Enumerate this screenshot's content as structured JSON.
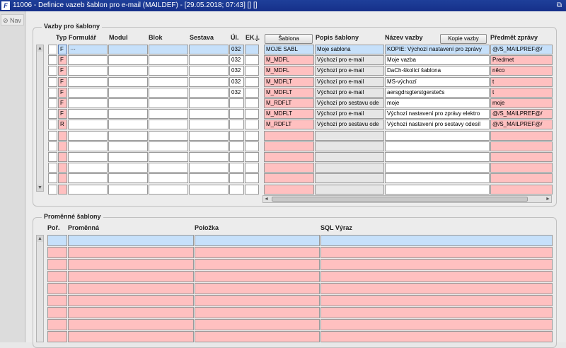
{
  "window": {
    "title": "11006 - Definice vazeb šablon pro e-mail (MAILDEF) - [29.05.2018; 07:43] [] []",
    "icon_text": "F",
    "controls": [
      "⧉",
      "✕"
    ]
  },
  "nav": {
    "label": "Nav"
  },
  "vazby": {
    "group_title": "Vazby pro šablony",
    "headers": {
      "typ": "Typ",
      "formular": "Formulář",
      "modul": "Modul",
      "blok": "Blok",
      "sestava": "Sestava",
      "ul": "Úl.",
      "ekj": "EK.j.",
      "popis": "Popis šablony",
      "nazev": "Název vazby",
      "predmet": "Předmět zprávy"
    },
    "sablona_button": "Šablona",
    "kopie_button": "Kopie vazby",
    "left_rows": [
      {
        "typ": "F",
        "formular": "···",
        "ul": "032"
      },
      {
        "typ": "F",
        "formular": "",
        "ul": "032"
      },
      {
        "typ": "F",
        "formular": "",
        "ul": "032"
      },
      {
        "typ": "F",
        "formular": "",
        "ul": "032"
      },
      {
        "typ": "F",
        "formular": "",
        "ul": "032"
      },
      {
        "typ": "F",
        "formular": "",
        "ul": ""
      },
      {
        "typ": "F",
        "formular": "",
        "ul": ""
      },
      {
        "typ": "R",
        "formular": "",
        "ul": ""
      },
      {
        "typ": "",
        "formular": "",
        "ul": ""
      },
      {
        "typ": "",
        "formular": "",
        "ul": ""
      },
      {
        "typ": "",
        "formular": "",
        "ul": ""
      },
      {
        "typ": "",
        "formular": "",
        "ul": ""
      },
      {
        "typ": "",
        "formular": "",
        "ul": ""
      },
      {
        "typ": "",
        "formular": "",
        "ul": ""
      }
    ],
    "right_rows": [
      {
        "sablona": "MOJE SABL",
        "popis": "Moje sablona",
        "nazev": "KOPIE: Výchozí nastavení pro zprávy",
        "predmet": "@/S_MAILPREF@/"
      },
      {
        "sablona": "M_MDFL",
        "popis": "Výchozí pro e-mail",
        "nazev": "Moje vazba",
        "predmet": "Predmet"
      },
      {
        "sablona": "M_MDFL",
        "popis": "Výchozí pro e-mail",
        "nazev": "DaCh-školící šablona",
        "predmet": "něco"
      },
      {
        "sablona": "M_MDFLT",
        "popis": "Výchozí pro e-mail",
        "nazev": "MS-výchozí",
        "predmet": "t"
      },
      {
        "sablona": "M_MDFLT",
        "popis": "Výchozí pro e-mail",
        "nazev": "aersgdrsgterstgerstečs",
        "predmet": "t"
      },
      {
        "sablona": "M_RDFLT",
        "popis": "Výchozí pro sestavu ode",
        "nazev": "moje",
        "predmet": "moje"
      },
      {
        "sablona": "M_MDFLT",
        "popis": "Výchozí pro e-mail",
        "nazev": "Výchozí nastavení pro zprávy elektro",
        "predmet": "@/S_MAILPREF@/"
      },
      {
        "sablona": "M_RDFLT",
        "popis": "Výchozí pro sestavu ode",
        "nazev": "Výchozí nastavení pro sestavy odesíl",
        "predmet": "@/S_MAILPREF@/"
      },
      {
        "sablona": "",
        "popis": "",
        "nazev": "",
        "predmet": ""
      },
      {
        "sablona": "",
        "popis": "",
        "nazev": "",
        "predmet": ""
      },
      {
        "sablona": "",
        "popis": "",
        "nazev": "",
        "predmet": ""
      },
      {
        "sablona": "",
        "popis": "",
        "nazev": "",
        "predmet": ""
      },
      {
        "sablona": "",
        "popis": "",
        "nazev": "",
        "predmet": ""
      },
      {
        "sablona": "",
        "popis": "",
        "nazev": "",
        "predmet": ""
      }
    ]
  },
  "promenne": {
    "group_title": "Proměnné šablony",
    "headers": {
      "por": "Poř.",
      "promenna": "Proměnná",
      "polozka": "Položka",
      "sql": "SQL Výraz"
    },
    "row_count": 9
  },
  "colors": {
    "required_pink": "#ffc0c0",
    "selected_blue": "#c6e0fa",
    "titlebar": "#1e3f9a"
  }
}
